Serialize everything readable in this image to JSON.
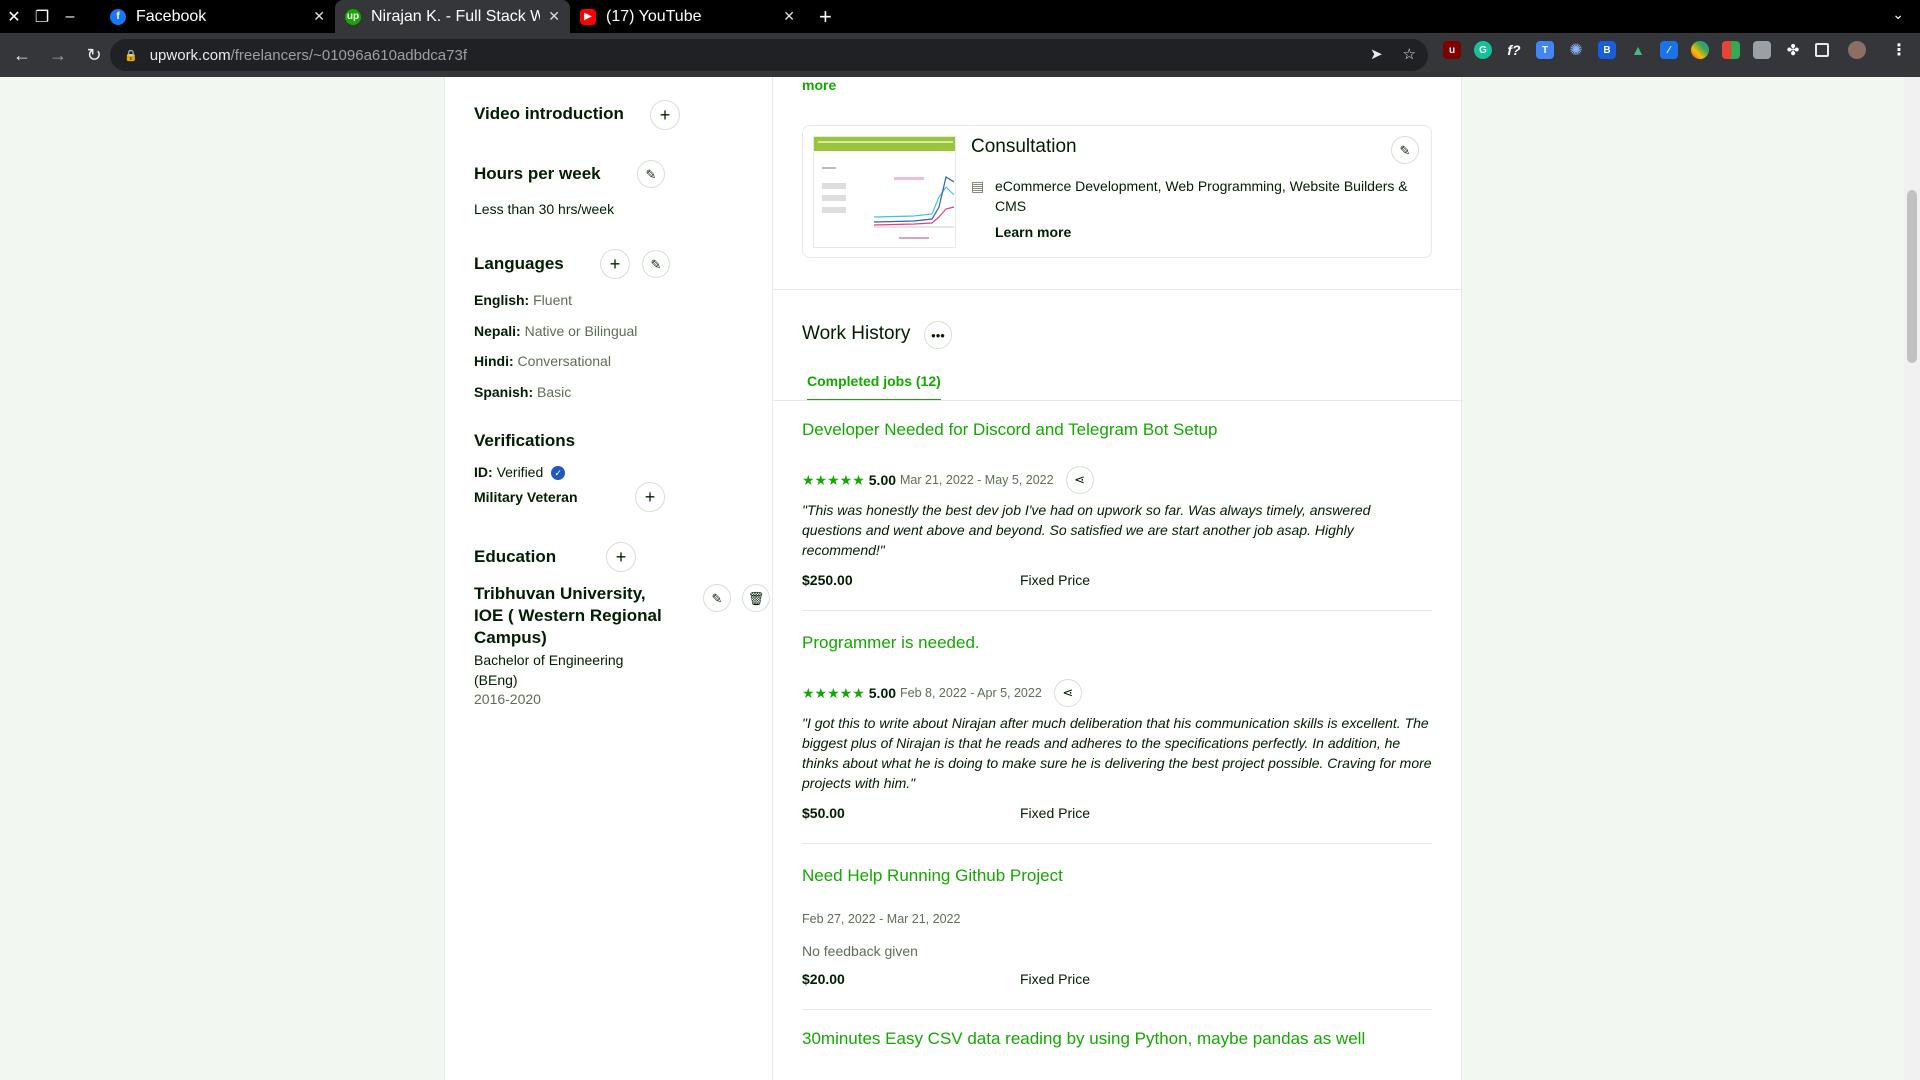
{
  "browser": {
    "tabs": [
      {
        "label": "Facebook",
        "favicon": "facebook-icon",
        "color": "#1877f2"
      },
      {
        "label": "Nirajan K. - Full Stack Web",
        "favicon": "upwork-icon",
        "color": "#14a800"
      },
      {
        "label": "(17) YouTube",
        "favicon": "youtube-icon",
        "color": "#ff0000"
      }
    ],
    "url_domain": "upwork.com",
    "url_path": "/freelancers/~01096a610adbdca73f"
  },
  "sidebar": {
    "video_intro": "Video introduction",
    "hours_title": "Hours per week",
    "hours_value": "Less than 30 hrs/week",
    "languages_title": "Languages",
    "languages": [
      {
        "name": "English:",
        "level": "Fluent"
      },
      {
        "name": "Nepali:",
        "level": "Native or Bilingual"
      },
      {
        "name": "Hindi:",
        "level": "Conversational"
      },
      {
        "name": "Spanish:",
        "level": "Basic"
      }
    ],
    "verifications_title": "Verifications",
    "id_label": "ID:",
    "id_value": "Verified",
    "military": "Military Veteran",
    "education_title": "Education",
    "school": "Tribhuvan University, IOE ( Western Regional Campus)",
    "degree": "Bachelor of Engineering (BEng)",
    "years": "2016-2020"
  },
  "main": {
    "more": "more",
    "consultation": {
      "title": "Consultation",
      "category": "eCommerce Development, Web Programming, Website Builders & CMS",
      "learn_more": "Learn more"
    },
    "work_history_title": "Work History",
    "completed_tab": "Completed jobs (12)",
    "jobs": [
      {
        "title": "Developer Needed for Discord and Telegram Bot Setup",
        "stars": "★★★★★",
        "score": "5.00",
        "dates": "Mar 21, 2022 - May 5, 2022",
        "feedback": "\"This was honestly the best dev job I've had on upwork so far. Was always timely, answered questions and went above and beyond. So satisfied we are start another job asap. Highly recommend!\"",
        "price": "$250.00",
        "type": "Fixed Price"
      },
      {
        "title": "Programmer is needed.",
        "stars": "★★★★★",
        "score": "5.00",
        "dates": "Feb 8, 2022 - Apr 5, 2022",
        "feedback": "\"I got this to write about Nirajan after much deliberation that his communication skills is excellent. The biggest plus of Nirajan is that he reads and adheres to the specifications perfectly. In addition, he thinks about what he is doing to make sure he is delivering the best project possible. Craving for more projects with him.\"",
        "price": "$50.00",
        "type": "Fixed Price"
      },
      {
        "title": "Need Help Running Github Project",
        "dates": "Feb 27, 2022 - Mar 21, 2022",
        "feedback": "No feedback given",
        "price": "$20.00",
        "type": "Fixed Price"
      },
      {
        "title": "30minutes Easy CSV data reading by using Python, maybe pandas as well"
      }
    ]
  },
  "colors": {
    "brand_green": "#14a800",
    "verified_blue": "#1f57c3"
  }
}
